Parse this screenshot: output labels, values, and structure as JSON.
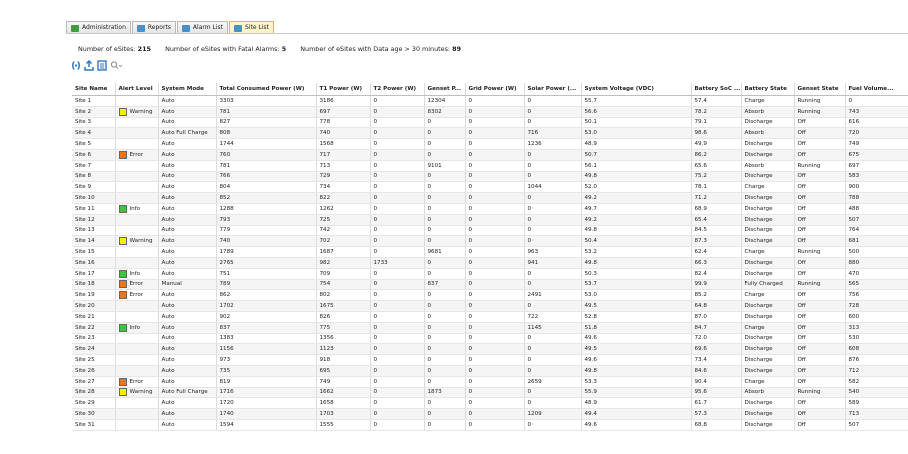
{
  "tabs": [
    {
      "label": "Administration",
      "icon": "admin-icon",
      "color": "#3e9b3e",
      "active": false
    },
    {
      "label": "Reports",
      "icon": "reports-icon",
      "color": "#4a90c8",
      "active": false
    },
    {
      "label": "Alarm List",
      "icon": "alarm-list-icon",
      "color": "#4a90c8",
      "active": false
    },
    {
      "label": "Site List",
      "icon": "site-list-icon",
      "color": "#4a90c8",
      "active": true
    }
  ],
  "summary": {
    "esites_label": "Number of eSites:",
    "esites_value": "215",
    "fatal_label": "Number of eSites with Fatal Alarms:",
    "fatal_value": "5",
    "age_label": "Number of eSites with Data age > 30 minutes:",
    "age_value": "89"
  },
  "toolbar": {
    "icons": [
      "refresh-icon",
      "export-icon",
      "report-icon",
      "search-icon"
    ],
    "accent": "#2f78c4"
  },
  "alert_colors": {
    "Warning": "#f2f200",
    "Error": "#e8761c",
    "Info": "#3ec43e"
  },
  "columns": [
    "Site Name",
    "Alert Level",
    "System Mode",
    "Total Consumed Power (W)",
    "T1 Power (W)",
    "T2 Power (W)",
    "Genset P...",
    "Grid Power (W)",
    "Solar Power (...",
    "System Voltage (VDC)",
    "Battery SoC ...",
    "Battery State",
    "Genset State",
    "Fuel Volume..."
  ],
  "rows": [
    [
      "Site 1",
      "",
      "Auto",
      "3303",
      "3186",
      "0",
      "12304",
      "0",
      "0",
      "55.7",
      "57.4",
      "Charge",
      "Running",
      "0"
    ],
    [
      "Site 2",
      "Warning",
      "Auto",
      "781",
      "697",
      "0",
      "8302",
      "0",
      "0",
      "56.6",
      "78.2",
      "Absorb",
      "Running",
      "743"
    ],
    [
      "Site 3",
      "",
      "Auto",
      "827",
      "778",
      "0",
      "0",
      "0",
      "0",
      "50.1",
      "79.1",
      "Discharge",
      "Off",
      "616"
    ],
    [
      "Site 4",
      "",
      "Auto Full Charge",
      "808",
      "740",
      "0",
      "0",
      "0",
      "716",
      "53.0",
      "98.6",
      "Absorb",
      "Off",
      "720"
    ],
    [
      "Site 5",
      "",
      "Auto",
      "1744",
      "1568",
      "0",
      "0",
      "0",
      "1236",
      "48.9",
      "49.9",
      "Discharge",
      "Off",
      "749"
    ],
    [
      "Site 6",
      "Error",
      "Auto",
      "760",
      "717",
      "0",
      "0",
      "0",
      "0",
      "50.7",
      "86.2",
      "Discharge",
      "Off",
      "675"
    ],
    [
      "Site 7",
      "",
      "Auto",
      "781",
      "713",
      "0",
      "9101",
      "0",
      "0",
      "56.1",
      "65.6",
      "Absorb",
      "Running",
      "697"
    ],
    [
      "Site 8",
      "",
      "Auto",
      "766",
      "729",
      "0",
      "0",
      "0",
      "0",
      "49.8",
      "75.2",
      "Discharge",
      "Off",
      "583"
    ],
    [
      "Site 9",
      "",
      "Auto",
      "804",
      "734",
      "0",
      "0",
      "0",
      "1044",
      "52.0",
      "78.1",
      "Charge",
      "Off",
      "900"
    ],
    [
      "Site 10",
      "",
      "Auto",
      "852",
      "822",
      "0",
      "0",
      "0",
      "0",
      "49.2",
      "71.2",
      "Discharge",
      "Off",
      "788"
    ],
    [
      "Site 11",
      "Info",
      "Auto",
      "1288",
      "1262",
      "0",
      "0",
      "0",
      "0",
      "49.7",
      "68.9",
      "Discharge",
      "Off",
      "488"
    ],
    [
      "Site 12",
      "",
      "Auto",
      "793",
      "725",
      "0",
      "0",
      "0",
      "0",
      "49.2",
      "65.4",
      "Discharge",
      "Off",
      "507"
    ],
    [
      "Site 13",
      "",
      "Auto",
      "779",
      "742",
      "0",
      "0",
      "0",
      "0",
      "49.8",
      "84.5",
      "Discharge",
      "Off",
      "764"
    ],
    [
      "Site 14",
      "Warning",
      "Auto",
      "740",
      "702",
      "0",
      "0",
      "0",
      "0",
      "50.4",
      "87.3",
      "Discharge",
      "Off",
      "681"
    ],
    [
      "Site 15",
      "",
      "Auto",
      "1789",
      "1687",
      "0",
      "9681",
      "0",
      "963",
      "53.2",
      "62.4",
      "Charge",
      "Running",
      "500"
    ],
    [
      "Site 16",
      "",
      "Auto",
      "2765",
      "982",
      "1733",
      "0",
      "0",
      "941",
      "49.8",
      "66.3",
      "Discharge",
      "Off",
      "880"
    ],
    [
      "Site 17",
      "Info",
      "Auto",
      "751",
      "709",
      "0",
      "0",
      "0",
      "0",
      "50.3",
      "82.4",
      "Discharge",
      "Off",
      "470"
    ],
    [
      "Site 18",
      "Error",
      "Manual",
      "789",
      "754",
      "0",
      "837",
      "0",
      "0",
      "53.7",
      "99.9",
      "Fully Charged",
      "Running",
      "565"
    ],
    [
      "Site 19",
      "Error",
      "Auto",
      "862",
      "802",
      "0",
      "0",
      "0",
      "2491",
      "53.0",
      "85.2",
      "Charge",
      "Off",
      "756"
    ],
    [
      "Site 20",
      "",
      "Auto",
      "1702",
      "1675",
      "0",
      "0",
      "0",
      "0",
      "49.5",
      "64.8",
      "Discharge",
      "Off",
      "728"
    ],
    [
      "Site 21",
      "",
      "Auto",
      "902",
      "826",
      "0",
      "0",
      "0",
      "722",
      "52.8",
      "87.0",
      "Discharge",
      "Off",
      "600"
    ],
    [
      "Site 22",
      "Info",
      "Auto",
      "837",
      "775",
      "0",
      "0",
      "0",
      "1145",
      "51.8",
      "84.7",
      "Charge",
      "Off",
      "313"
    ],
    [
      "Site 23",
      "",
      "Auto",
      "1383",
      "1356",
      "0",
      "0",
      "0",
      "0",
      "49.6",
      "72.0",
      "Discharge",
      "Off",
      "530"
    ],
    [
      "Site 24",
      "",
      "Auto",
      "1156",
      "1123",
      "0",
      "0",
      "0",
      "0",
      "49.5",
      "69.6",
      "Discharge",
      "Off",
      "608"
    ],
    [
      "Site 25",
      "",
      "Auto",
      "973",
      "918",
      "0",
      "0",
      "0",
      "0",
      "49.6",
      "73.4",
      "Discharge",
      "Off",
      "876"
    ],
    [
      "Site 26",
      "",
      "Auto",
      "735",
      "695",
      "0",
      "0",
      "0",
      "0",
      "49.8",
      "84.6",
      "Discharge",
      "Off",
      "712"
    ],
    [
      "Site 27",
      "Error",
      "Auto",
      "819",
      "749",
      "0",
      "0",
      "0",
      "2659",
      "53.3",
      "90.4",
      "Charge",
      "Off",
      "582"
    ],
    [
      "Site 28",
      "Warning",
      "Auto Full Charge",
      "1716",
      "1662",
      "0",
      "1873",
      "0",
      "0",
      "55.9",
      "95.6",
      "Absorb",
      "Running",
      "540"
    ],
    [
      "Site 29",
      "",
      "Auto",
      "1720",
      "1658",
      "0",
      "0",
      "0",
      "0",
      "48.9",
      "61.7",
      "Discharge",
      "Off",
      "589"
    ],
    [
      "Site 30",
      "",
      "Auto",
      "1740",
      "1703",
      "0",
      "0",
      "0",
      "1209",
      "49.4",
      "57.3",
      "Discharge",
      "Off",
      "713"
    ],
    [
      "Site 31",
      "",
      "Auto",
      "1594",
      "1555",
      "0",
      "0",
      "0",
      "0",
      "49.6",
      "68.8",
      "Discharge",
      "Off",
      "507"
    ]
  ]
}
